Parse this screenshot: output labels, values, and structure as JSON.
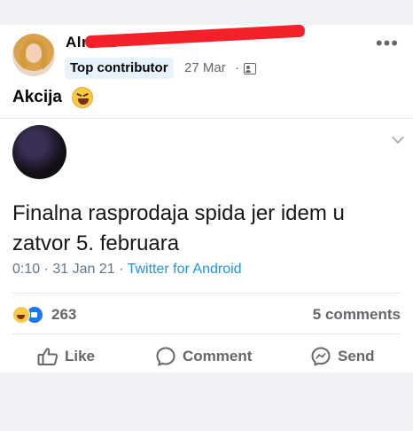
{
  "post": {
    "author": "Alma D",
    "badge": "Top contributor",
    "date": "27 Mar",
    "separator": "·",
    "audience_icon": "friends-icon",
    "caption": "Akcija",
    "caption_emoji": "laughing-emoji"
  },
  "tweet": {
    "text": "Finalna rasprodaja spida jer idem u zatvor 5. februara",
    "time": "0:10",
    "date": "31 Jan 21",
    "source": "Twitter for Android"
  },
  "stats": {
    "reactions_count": "263",
    "comments_label": "5 comments"
  },
  "actions": {
    "like_label": "Like",
    "comment_label": "Comment",
    "send_label": "Send"
  },
  "colors": {
    "badge_bg": "#e7f3ff",
    "twitter_link": "#1b95e0",
    "redaction": "#f4202a",
    "secondary_text": "#65676b"
  }
}
